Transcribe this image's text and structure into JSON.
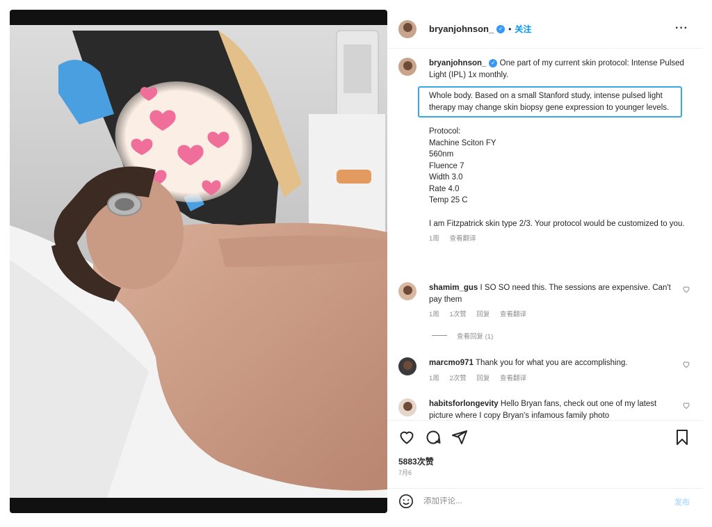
{
  "post": {
    "username": "bryanjohnson_",
    "follow_label": "关注",
    "more_label": "···",
    "caption_intro": "One part of my current skin protocol: Intense Pulsed Light (IPL) 1x monthly.",
    "caption_highlight": "Whole body. Based on a small Stanford study, intense pulsed light therapy may change skin biopsy gene expression to younger levels.",
    "protocol_lines": [
      "Protocol:",
      "Machine Sciton FY",
      "560nm",
      "Fluence 7",
      "Width 3.0",
      "Rate 4.0",
      "Temp 25 C"
    ],
    "fitzpatrick_note": "I am Fitzpatrick skin type 2/3. Your protocol would be customized to you.",
    "caption_time": "1周",
    "see_translation": "查看翻译",
    "likes_count": "5883次赞",
    "date": "7月6"
  },
  "comments": [
    {
      "username": "shamim_gus",
      "text": "I SO SO need this. The sessions are expensive. Can't pay them",
      "time": "1周",
      "likes": "1次赞",
      "reply": "回复",
      "see_translation": "查看翻译",
      "view_replies": "查看回复 (1)"
    },
    {
      "username": "marcmo971",
      "text": "Thank you for what you are accomplishing.",
      "time": "1周",
      "likes": "2次赞",
      "reply": "回复",
      "see_translation": "查看翻译"
    },
    {
      "username": "habitsforlongevity",
      "text": "Hello Bryan fans, check out one of my latest picture where I copy Bryan's infamous family photo"
    }
  ],
  "comment_box": {
    "placeholder": "添加评论...",
    "post_label": "发布"
  },
  "icons": {
    "like": "heart-icon",
    "comment": "comment-icon",
    "share": "share-icon",
    "save": "bookmark-icon",
    "emoji": "emoji-icon"
  },
  "colors": {
    "link": "#0095f6",
    "verified": "#3897f0",
    "highlight_border": "#3aa6e6"
  }
}
